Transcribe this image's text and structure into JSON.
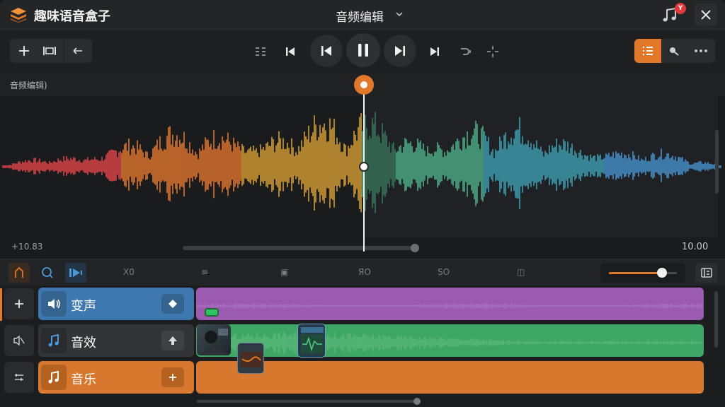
{
  "app": {
    "title": "趣味语音盒子",
    "center_title": "音频编辑",
    "notification_count": "Y"
  },
  "waveform": {
    "label": "音频编辑)",
    "time_left": "+10.83",
    "time_right": "10.00",
    "colors": [
      "#e8484b",
      "#ea7a2e",
      "#e0a535",
      "#4fb58b",
      "#3fa5b8",
      "#4897d4"
    ]
  },
  "timeline": {
    "ticks": [
      "X0",
      "≡",
      "▣",
      "ЯO",
      "SO",
      "◫"
    ],
    "zoom_level": 0.78
  },
  "tracks": [
    {
      "name": "变声",
      "color": "#3f78b1",
      "clip_color": "#9a5bb0",
      "icon": "speaker-icon",
      "action_icon": "diamond-icon",
      "side_icon": "plus-icon"
    },
    {
      "name": "音效",
      "color": "#3a3b3f",
      "clip_color": "#3ea765",
      "icon": "music-note-icon",
      "action_icon": "arrow-up-icon",
      "side_icon": "mute-icon"
    },
    {
      "name": "音乐",
      "color": "#d8782e",
      "clip_color": "#d8782e",
      "icon": "music-note-icon",
      "action_icon": "plus-icon",
      "side_icon": "list-icon"
    }
  ],
  "accent": "#e2782a"
}
